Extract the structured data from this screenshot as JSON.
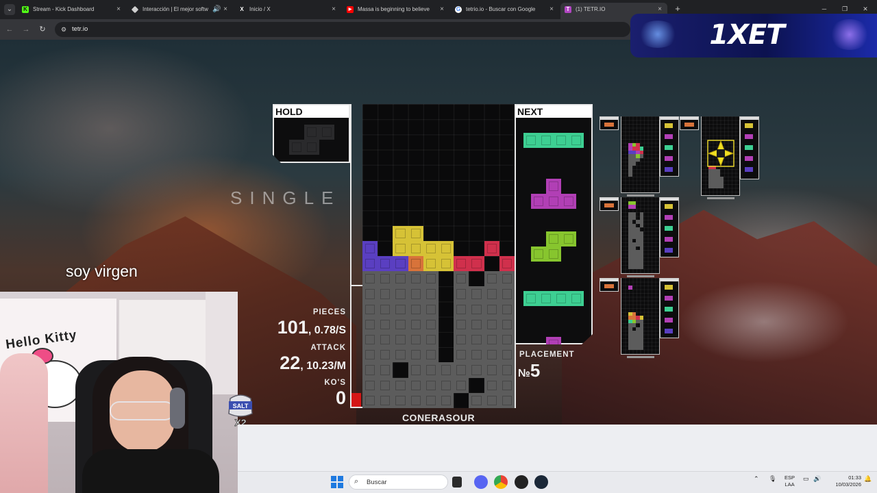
{
  "browser": {
    "tabs": [
      {
        "label": "Stream - Kick Dashboard",
        "favicon": "kick-icon",
        "color": "#53fc18"
      },
      {
        "label": "Interacción | El mejor softw",
        "favicon": "diamond-icon",
        "color": "#cfcfcf"
      },
      {
        "label": "Inicio / X",
        "favicon": "x-icon",
        "color": "#ffffff"
      },
      {
        "label": "Massa is beginning to believe",
        "favicon": "youtube-icon",
        "color": "#ff0000"
      },
      {
        "label": "tetrio.io - Buscar con Google",
        "favicon": "google-icon",
        "color": "#ffffff"
      },
      {
        "label": "(1) TETR.IO",
        "favicon": "tetrio-icon",
        "color": "#b146c2"
      }
    ],
    "active_tab": 5,
    "url": "tetr.io",
    "new_tab_symbol": "+",
    "close_symbol": "×"
  },
  "ad": {
    "logo": "1XET"
  },
  "game": {
    "clear_text": "SINGLE",
    "hold_label": "HOLD",
    "next_label": "NEXT",
    "hold_piece": "S",
    "next_queue": [
      "I",
      "T",
      "S",
      "I",
      "T"
    ],
    "stats": {
      "pieces_label": "PIECES",
      "pieces_value": "101",
      "pieces_rate": "0.78/S",
      "attack_label": "ATTACK",
      "attack_value": "22",
      "attack_rate": "10.23/M",
      "kos_label": "KO'S",
      "kos_value": "0"
    },
    "placement_label": "PLACEMENT",
    "placement_prefix": "№",
    "placement_value": "5",
    "player_name": "CONERASOUR",
    "colors": {
      "I": "#3dcf92",
      "T": "#b13fb5",
      "S": "#87c52e",
      "Z": "#d0304c",
      "O": "#d6c236",
      "L": "#d8733a",
      "J": "#5a3fc1",
      "garbage": "#5c5c5c"
    }
  },
  "stream": {
    "caption": "soy virgen",
    "webcam_poster": "Hello Kitty",
    "badge_text": "SALT",
    "badge_multiplier": "X2"
  },
  "taskbar": {
    "search_placeholder": "Buscar",
    "lang_top": "ESP",
    "lang_bottom": "LAA",
    "time": "01:33",
    "date": "10/03/2026"
  }
}
